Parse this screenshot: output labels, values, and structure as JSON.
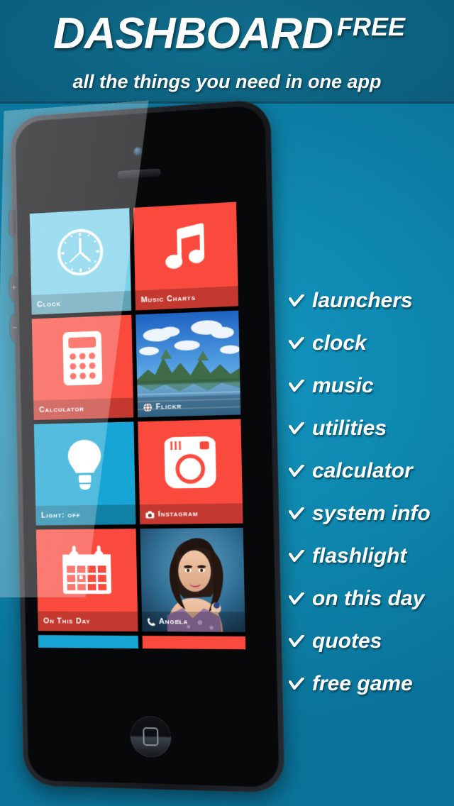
{
  "header": {
    "title_main": "DASHBOARD",
    "title_badge": "FREE",
    "subtitle": "all the things you need in one app",
    "band_color": "#0d6180"
  },
  "theme": {
    "background_color": "#0e87ae",
    "tile_red": "#fa4a3e",
    "tile_light_blue": "#7bd0ea",
    "tile_blue": "#16a5d4",
    "text_white": "#ffffff"
  },
  "features": {
    "bullet_icon": "check-icon",
    "items": [
      {
        "label": "launchers"
      },
      {
        "label": "clock"
      },
      {
        "label": "music"
      },
      {
        "label": "utilities"
      },
      {
        "label": "calculator"
      },
      {
        "label": "system info"
      },
      {
        "label": "flashlight"
      },
      {
        "label": "on this day"
      },
      {
        "label": "quotes"
      },
      {
        "label": "free game"
      }
    ]
  },
  "phone": {
    "hardware": {
      "camera": "front-camera",
      "speaker": "earpiece-speaker",
      "silent_switch": "silent-switch",
      "volume_up": "+",
      "volume_down": "−",
      "home_button": "home-button"
    },
    "app": {
      "next_button_icon": "arrow-right-circle-icon",
      "tiles": [
        {
          "label": "Clock",
          "style": "lblue",
          "icon": "clock-icon",
          "mini_icon": ""
        },
        {
          "label": "Music Charts",
          "style": "red",
          "icon": "music-note-icon",
          "mini_icon": ""
        },
        {
          "label": "Calculator",
          "style": "red",
          "icon": "calculator-icon",
          "mini_icon": ""
        },
        {
          "label": "Flickr",
          "style": "photo",
          "icon": "landscape-photo",
          "mini_icon": "globe-icon"
        },
        {
          "label": "Light: off",
          "style": "blue",
          "icon": "lightbulb-icon",
          "mini_icon": ""
        },
        {
          "label": "Instagram",
          "style": "red",
          "icon": "instagram-icon",
          "mini_icon": "instagram-mini-icon"
        },
        {
          "label": "On This Day",
          "style": "red",
          "icon": "calendar-icon",
          "mini_icon": ""
        },
        {
          "label": "Angela",
          "style": "photo",
          "icon": "portrait-photo",
          "mini_icon": "phone-icon"
        }
      ],
      "partial_row": [
        {
          "style": "blue"
        },
        {
          "style": "red"
        }
      ]
    }
  }
}
